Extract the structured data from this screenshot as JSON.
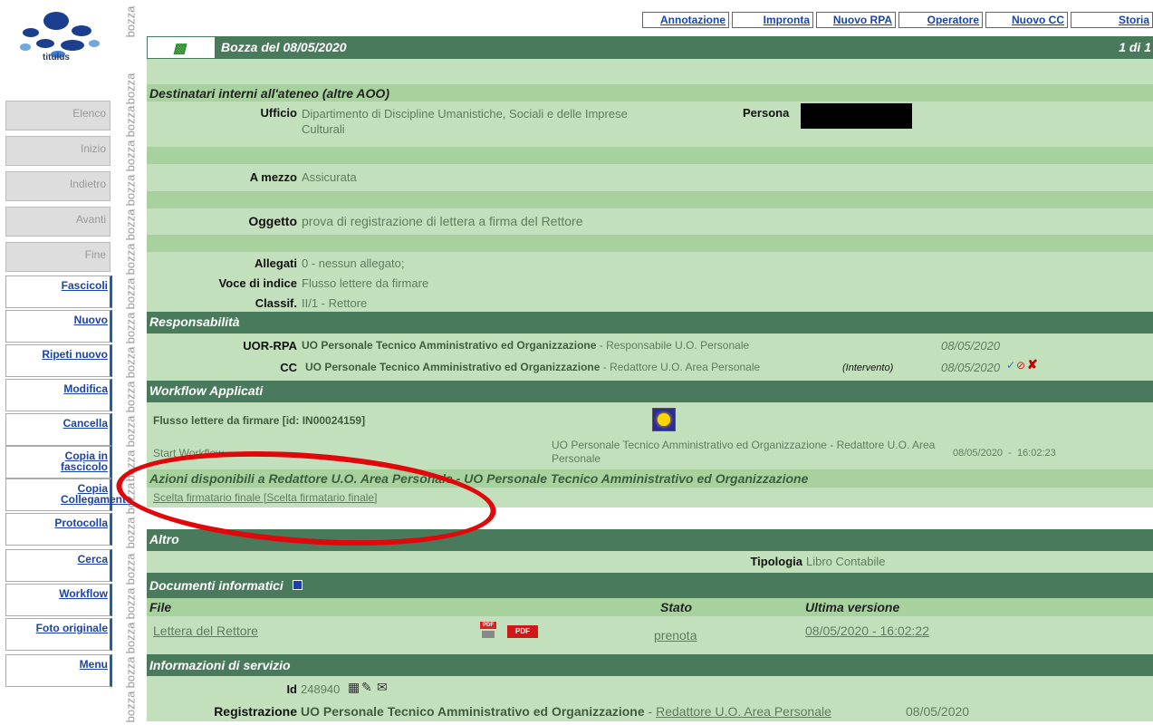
{
  "app": {
    "logo_text": "titulus",
    "watermark": "bozza"
  },
  "nav_disabled": [
    "Elenco",
    "Inizio",
    "Indietro",
    "Avanti",
    "Fine"
  ],
  "nav_links": [
    "Fascicoli",
    "Nuovo",
    "Ripeti nuovo",
    "Modifica",
    "Cancella",
    "Copia in fascicolo",
    "Copia Collegamento",
    "Protocolla",
    "Cerca",
    "Workflow",
    "Foto originale",
    "Menu"
  ],
  "top_links": [
    "Annotazione",
    "Impronta",
    "Nuovo RPA",
    "Operatore",
    "Nuovo CC",
    "Storia"
  ],
  "title": {
    "text": "Bozza del 08/05/2020",
    "page": "1 di 1"
  },
  "destinatari": {
    "header": "Destinatari interni all'ateneo (altre AOO)",
    "ufficio_label": "Ufficio",
    "ufficio_value": "Dipartimento di Discipline Umanistiche, Sociali e delle Imprese Culturali",
    "persona_label": "Persona"
  },
  "a_mezzo": {
    "label": "A mezzo",
    "value": "Assicurata"
  },
  "oggetto": {
    "label": "Oggetto",
    "value": "prova di registrazione di lettera a firma del Rettore"
  },
  "allegati": {
    "label": "Allegati",
    "value": "0 - nessun allegato;"
  },
  "voce_indice": {
    "label": "Voce di indice",
    "value": "Flusso lettere da firmare"
  },
  "classif": {
    "label": "Classif.",
    "value": "II/1 - Rettore"
  },
  "responsabilita": {
    "header": "Responsabilità",
    "uor_label": "UOR-RPA",
    "uor_office": "UO Personale Tecnico Amministrativo ed Organizzazione",
    "uor_role": " - Responsabile U.O. Personale",
    "uor_date": "08/05/2020",
    "cc_label": "CC",
    "cc_office": "UO Personale Tecnico Amministrativo ed Organizzazione",
    "cc_role": " - Redattore U.O. Area Personale",
    "cc_note": "(Intervento)",
    "cc_date": "08/05/2020"
  },
  "workflow": {
    "header": "Workflow Applicati",
    "flow_name": "Flusso lettere da firmare [id: IN00024159]",
    "step": "Start Workflow",
    "step_actor": "UO Personale Tecnico Amministrativo ed Organizzazione - Redattore U.O. Area Personale",
    "step_time": "08/05/2020  -  16:02:23",
    "actions_header": "Azioni disponibili a Redattore U.O. Area Personale - UO Personale Tecnico Amministrativo ed Organizzazione",
    "action_link": "Scelta firmatario finale [Scelta firmatario finale]"
  },
  "altro": {
    "header": "Altro",
    "tipologia_label": "Tipologia",
    "tipologia_value": "Libro Contabile"
  },
  "documenti": {
    "header": "Documenti informatici",
    "col_file": "File",
    "col_stato": "Stato",
    "col_versione": "Ultima versione",
    "file": "Lettera del Rettore",
    "stato": "prenota",
    "versione": "08/05/2020 - 16:02:22"
  },
  "servizio": {
    "header": "Informazioni di servizio",
    "id_label": "Id",
    "id_value": "248940",
    "reg_label": "Registrazione",
    "reg_office": "UO Personale Tecnico Amministrativo ed Organizzazione",
    "reg_sep": " - ",
    "reg_role": "Redattore U.O. Area Personale",
    "reg_date": "08/05/2020"
  },
  "colors": {
    "header": "#4a7a5c",
    "light": "#c2e0bc",
    "medium": "#a7d29e",
    "annotation": "#e0080a"
  }
}
